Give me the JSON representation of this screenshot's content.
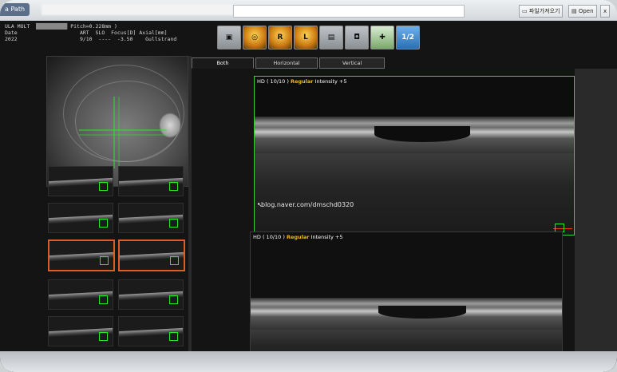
{
  "window": {
    "path_label": "a Path",
    "open_folder_label": "파일가져오기",
    "open_label": "Open",
    "close_label": "x"
  },
  "info": {
    "line1": "ULA MOLT",
    "line1_tail": "Pitch=0.228mm )",
    "header_date": "Date",
    "header_art": "ART",
    "header_slo": "SLO",
    "header_focus": "Focus[D]",
    "header_axial": "Axial[mm]",
    "val_date": "2022",
    "val_art": "9/10",
    "val_slo": "----",
    "val_focus": "-3.50",
    "val_axial": "Gullstrand"
  },
  "toolbar": {
    "tools": [
      {
        "name": "scanner-tool",
        "glyph": "▣",
        "style": "gray"
      },
      {
        "name": "fundus-eye-tool",
        "glyph": "◎",
        "style": "orange"
      },
      {
        "name": "right-eye-tool",
        "glyph": "R",
        "style": "orange"
      },
      {
        "name": "left-eye-tool",
        "glyph": "L",
        "style": "orange"
      },
      {
        "name": "device-tool",
        "glyph": "▤",
        "style": "gray"
      },
      {
        "name": "camera-tool",
        "glyph": "◘",
        "style": "gray"
      },
      {
        "name": "save-tool",
        "glyph": "✚",
        "style": "green"
      },
      {
        "name": "export-tool",
        "glyph": "1/2",
        "style": "blue"
      }
    ]
  },
  "tabs": {
    "both": "Both",
    "horizontal": "Horizontal",
    "vertical": "Vertical"
  },
  "scan_main": {
    "hd": "HD ( 10/10 )",
    "mode": "Regular",
    "intensity": "Intensity +5",
    "watermark": "blog.naver.com/dmschd0320"
  },
  "scan_bottom": {
    "hd": "HD ( 10/10 )",
    "mode": "Regular",
    "intensity": "Intensity +5"
  },
  "colors": {
    "selection": "#e05b25",
    "marker": "#2ce62c",
    "mode_label": "#f0b51c"
  }
}
